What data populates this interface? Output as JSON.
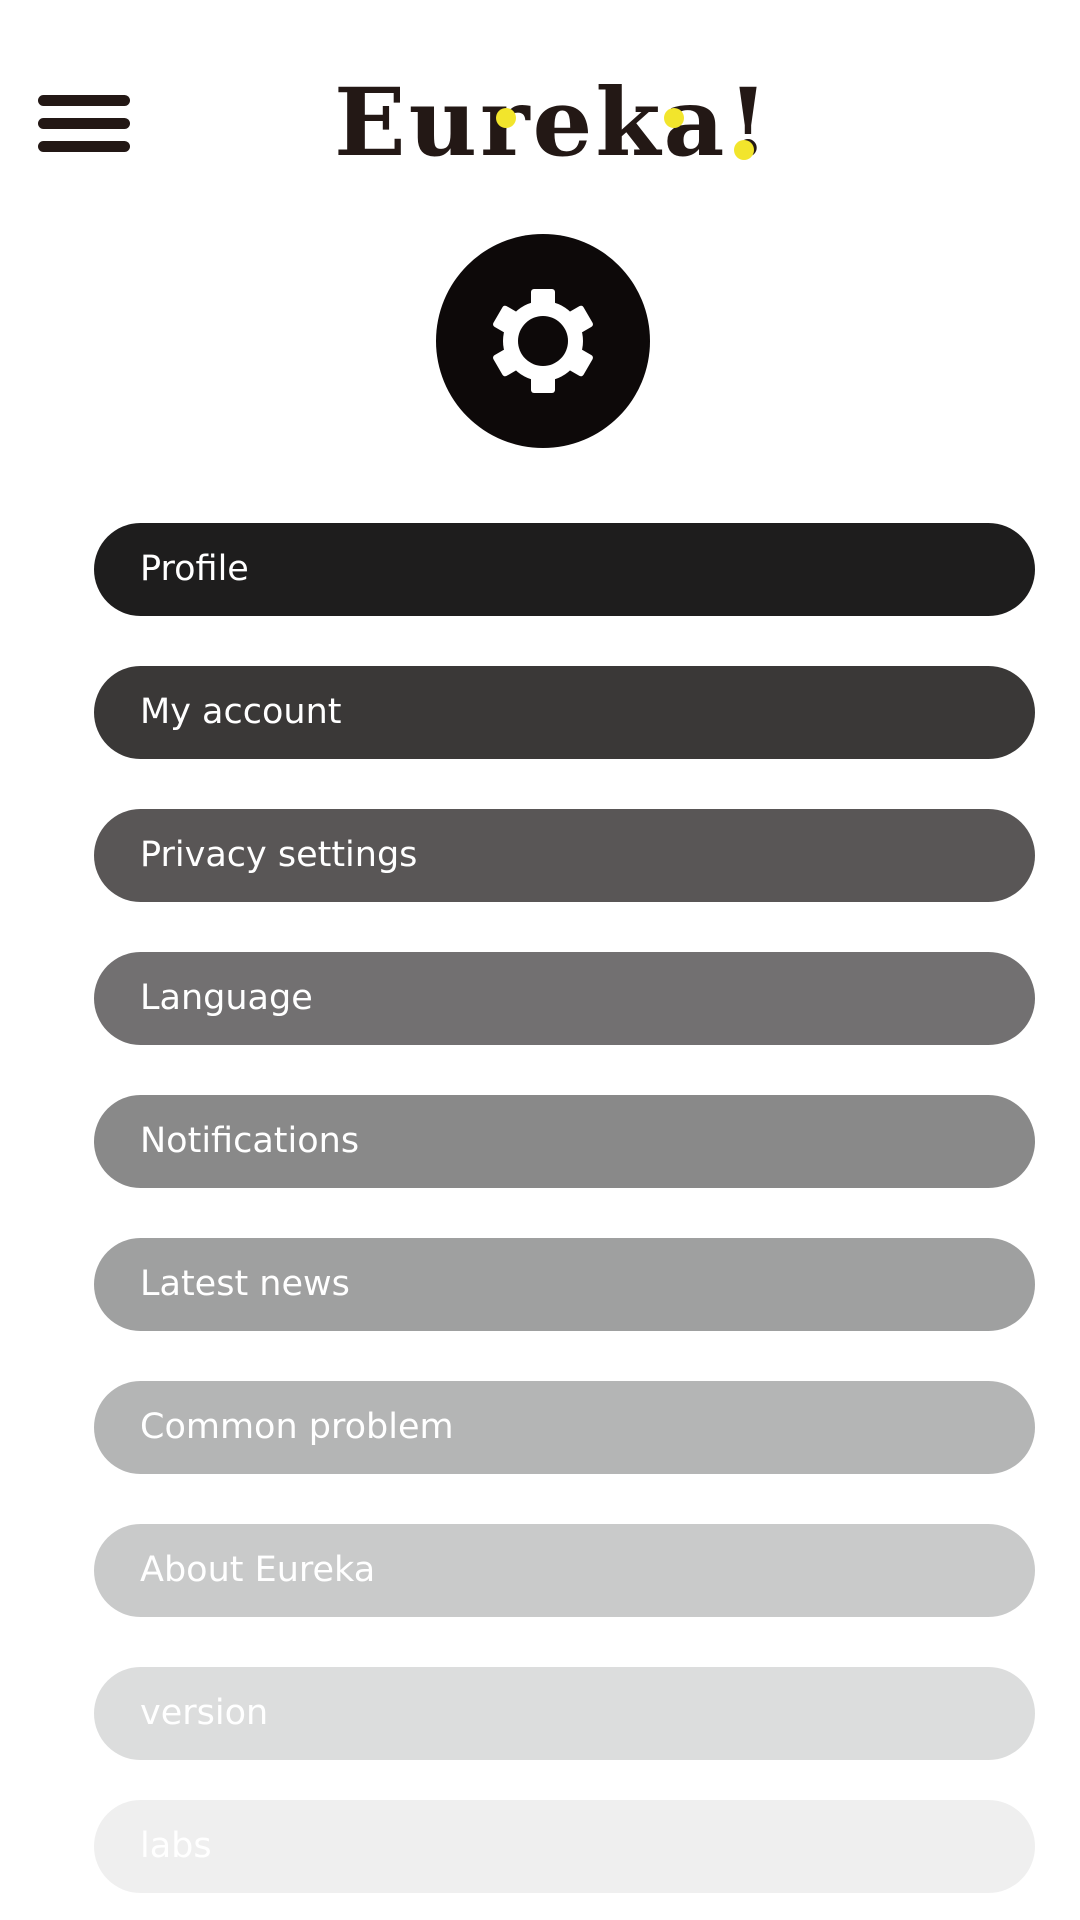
{
  "header": {
    "logo_text": "Eureka!",
    "menu_icon": "hamburger-menu-icon",
    "logo_accent_color": "#F2E52C",
    "brand_color": "#231815"
  },
  "settings_icon": "gear-icon",
  "settings": {
    "items": [
      {
        "label": "Profile",
        "bg": "#1e1d1d",
        "fg": "#ffffff"
      },
      {
        "label": "My account",
        "bg": "#3a3837",
        "fg": "#ffffff"
      },
      {
        "label": "Privacy settings",
        "bg": "#595656",
        "fg": "#ffffff"
      },
      {
        "label": "Language",
        "bg": "#727071",
        "fg": "#ffffff"
      },
      {
        "label": "Notifications",
        "bg": "#898989",
        "fg": "#ffffff"
      },
      {
        "label": "Latest news",
        "bg": "#9fa0a0",
        "fg": "#ffffff"
      },
      {
        "label": "Common problem",
        "bg": "#b4b5b5",
        "fg": "#ffffff"
      },
      {
        "label": "About Eureka",
        "bg": "#c9caca",
        "fg": "#ffffff"
      },
      {
        "label": "version",
        "bg": "#dcdddd",
        "fg": "#ffffff"
      },
      {
        "label": "labs",
        "bg": "#efefef",
        "fg": "#ffffff"
      }
    ]
  }
}
